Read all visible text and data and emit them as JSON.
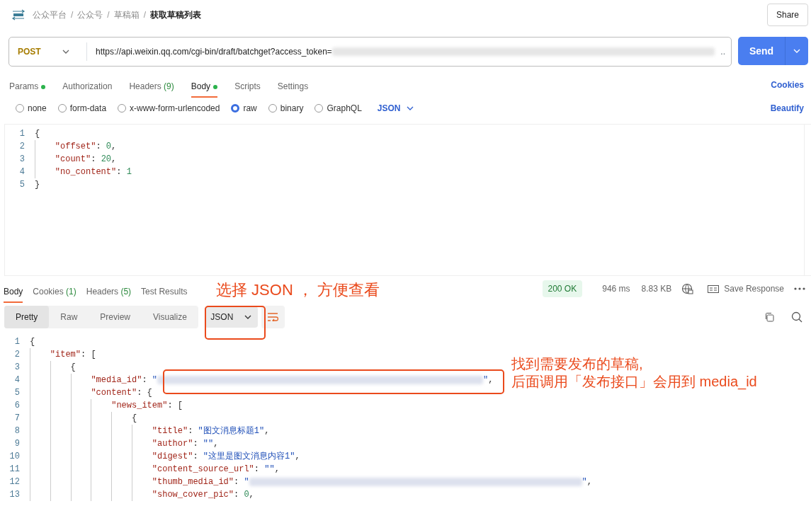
{
  "breadcrumb": [
    {
      "text": "公众平台",
      "current": false
    },
    {
      "text": "公众号",
      "current": false
    },
    {
      "text": "草稿箱",
      "current": false
    },
    {
      "text": "获取草稿列表",
      "current": true
    }
  ],
  "breadcrumb_separators": [
    "/",
    "/",
    "/"
  ],
  "share_button": "Share",
  "request": {
    "method": "POST",
    "url": "https://api.weixin.qq.com/cgi-bin/draft/batchget?access_token=",
    "url_ellipsis": "..",
    "send": "Send"
  },
  "request_tabs": [
    {
      "label": "Params",
      "dot": true,
      "selected": false
    },
    {
      "label": "Authorization",
      "dot": false,
      "selected": false
    },
    {
      "label": "Headers",
      "count": "(9)",
      "dot": false,
      "selected": false
    },
    {
      "label": "Body",
      "dot": true,
      "selected": true
    },
    {
      "label": "Scripts",
      "dot": false,
      "selected": false
    },
    {
      "label": "Settings",
      "dot": false,
      "selected": false
    }
  ],
  "cookies_link": "Cookies",
  "body_types": [
    {
      "label": "none",
      "selected": false
    },
    {
      "label": "form-data",
      "selected": false
    },
    {
      "label": "x-www-form-urlencoded",
      "selected": false
    },
    {
      "label": "raw",
      "selected": true
    },
    {
      "label": "binary",
      "selected": false
    },
    {
      "label": "GraphQL",
      "selected": false
    }
  ],
  "body_format": "JSON",
  "beautify": "Beautify",
  "request_body": [
    {
      "number": "1",
      "tokens": [
        {
          "kind": "punct",
          "text": "{"
        }
      ],
      "children": [
        {
          "number": "2",
          "tokens": [
            {
              "kind": "key",
              "text": "\"offset\""
            },
            {
              "kind": "punct",
              "text": ": "
            },
            {
              "kind": "num",
              "text": "0"
            },
            {
              "kind": "punct",
              "text": ","
            }
          ]
        },
        {
          "number": "3",
          "tokens": [
            {
              "kind": "key",
              "text": "\"count\""
            },
            {
              "kind": "punct",
              "text": ": "
            },
            {
              "kind": "num",
              "text": "20"
            },
            {
              "kind": "punct",
              "text": ","
            }
          ]
        },
        {
          "number": "4",
          "tokens": [
            {
              "kind": "key",
              "text": "\"no_content\""
            },
            {
              "kind": "punct",
              "text": ": "
            },
            {
              "kind": "num",
              "text": "1"
            }
          ]
        }
      ]
    },
    {
      "number": "5",
      "tokens": [
        {
          "kind": "punct",
          "text": "}"
        }
      ]
    }
  ],
  "response_tabs": [
    {
      "label": "Body",
      "selected": true
    },
    {
      "label": "Cookies",
      "count": "(1)",
      "selected": false
    },
    {
      "label": "Headers",
      "count": "(5)",
      "selected": false
    },
    {
      "label": "Test Results",
      "selected": false
    }
  ],
  "status": "200 OK",
  "time": "946 ms",
  "size": "8.83 KB",
  "save_response": "Save Response",
  "view_modes": [
    {
      "label": "Pretty",
      "selected": true
    },
    {
      "label": "Raw",
      "selected": false
    },
    {
      "label": "Preview",
      "selected": false
    },
    {
      "label": "Visualize",
      "selected": false
    }
  ],
  "response_format": "JSON",
  "response_body": [
    {
      "number": "1",
      "tokens": [
        {
          "kind": "punct",
          "text": "{"
        }
      ],
      "children": [
        {
          "number": "2",
          "tokens": [
            {
              "kind": "key",
              "text": "\"item\""
            },
            {
              "kind": "punct",
              "text": ": ["
            }
          ],
          "children": [
            {
              "number": "3",
              "tokens": [
                {
                  "kind": "punct",
                  "text": "{"
                }
              ],
              "children": [
                {
                  "number": "4",
                  "tokens": [
                    {
                      "kind": "key",
                      "text": "\"media_id\""
                    },
                    {
                      "kind": "punct",
                      "text": ": "
                    },
                    {
                      "kind": "str",
                      "text": "\""
                    },
                    {
                      "kind": "redacted"
                    },
                    {
                      "kind": "str",
                      "text": "\""
                    },
                    {
                      "kind": "punct",
                      "text": ","
                    }
                  ]
                },
                {
                  "number": "5",
                  "tokens": [
                    {
                      "kind": "key",
                      "text": "\"content\""
                    },
                    {
                      "kind": "punct",
                      "text": ": {"
                    }
                  ],
                  "children": [
                    {
                      "number": "6",
                      "tokens": [
                        {
                          "kind": "key",
                          "text": "\"news_item\""
                        },
                        {
                          "kind": "punct",
                          "text": ": ["
                        }
                      ],
                      "children": [
                        {
                          "number": "7",
                          "tokens": [
                            {
                              "kind": "punct",
                              "text": "{"
                            }
                          ],
                          "children": [
                            {
                              "number": "8",
                              "tokens": [
                                {
                                  "kind": "key",
                                  "text": "\"title\""
                                },
                                {
                                  "kind": "punct",
                                  "text": ": "
                                },
                                {
                                  "kind": "str",
                                  "text": "\"图文消息标题1\""
                                },
                                {
                                  "kind": "punct",
                                  "text": ","
                                }
                              ]
                            },
                            {
                              "number": "9",
                              "tokens": [
                                {
                                  "kind": "key",
                                  "text": "\"author\""
                                },
                                {
                                  "kind": "punct",
                                  "text": ": "
                                },
                                {
                                  "kind": "str",
                                  "text": "\"\""
                                },
                                {
                                  "kind": "punct",
                                  "text": ","
                                }
                              ]
                            },
                            {
                              "number": "10",
                              "tokens": [
                                {
                                  "kind": "key",
                                  "text": "\"digest\""
                                },
                                {
                                  "kind": "punct",
                                  "text": ": "
                                },
                                {
                                  "kind": "str",
                                  "text": "\"这里是图文消息内容1\""
                                },
                                {
                                  "kind": "punct",
                                  "text": ","
                                }
                              ]
                            },
                            {
                              "number": "11",
                              "tokens": [
                                {
                                  "kind": "key",
                                  "text": "\"content_source_url\""
                                },
                                {
                                  "kind": "punct",
                                  "text": ": "
                                },
                                {
                                  "kind": "str",
                                  "text": "\"\""
                                },
                                {
                                  "kind": "punct",
                                  "text": ","
                                }
                              ]
                            },
                            {
                              "number": "12",
                              "tokens": [
                                {
                                  "kind": "key",
                                  "text": "\"thumb_media_id\""
                                },
                                {
                                  "kind": "punct",
                                  "text": ": "
                                },
                                {
                                  "kind": "str",
                                  "text": "\""
                                },
                                {
                                  "kind": "redacted"
                                },
                                {
                                  "kind": "str",
                                  "text": "\""
                                },
                                {
                                  "kind": "punct",
                                  "text": ","
                                }
                              ]
                            },
                            {
                              "number": "13",
                              "tokens": [
                                {
                                  "kind": "key",
                                  "text": "\"show_cover_pic\""
                                },
                                {
                                  "kind": "punct",
                                  "text": ": "
                                },
                                {
                                  "kind": "num",
                                  "text": "0"
                                },
                                {
                                  "kind": "punct",
                                  "text": ","
                                }
                              ]
                            }
                          ]
                        }
                      ]
                    }
                  ]
                }
              ]
            }
          ]
        }
      ]
    }
  ],
  "annotations": [
    {
      "kind": "format-note",
      "text": "选择 JSON ， 方便查看"
    },
    {
      "kind": "media-note",
      "text": "找到需要发布的草稿,\n后面调用「发布接口」会用到 media_id"
    }
  ]
}
